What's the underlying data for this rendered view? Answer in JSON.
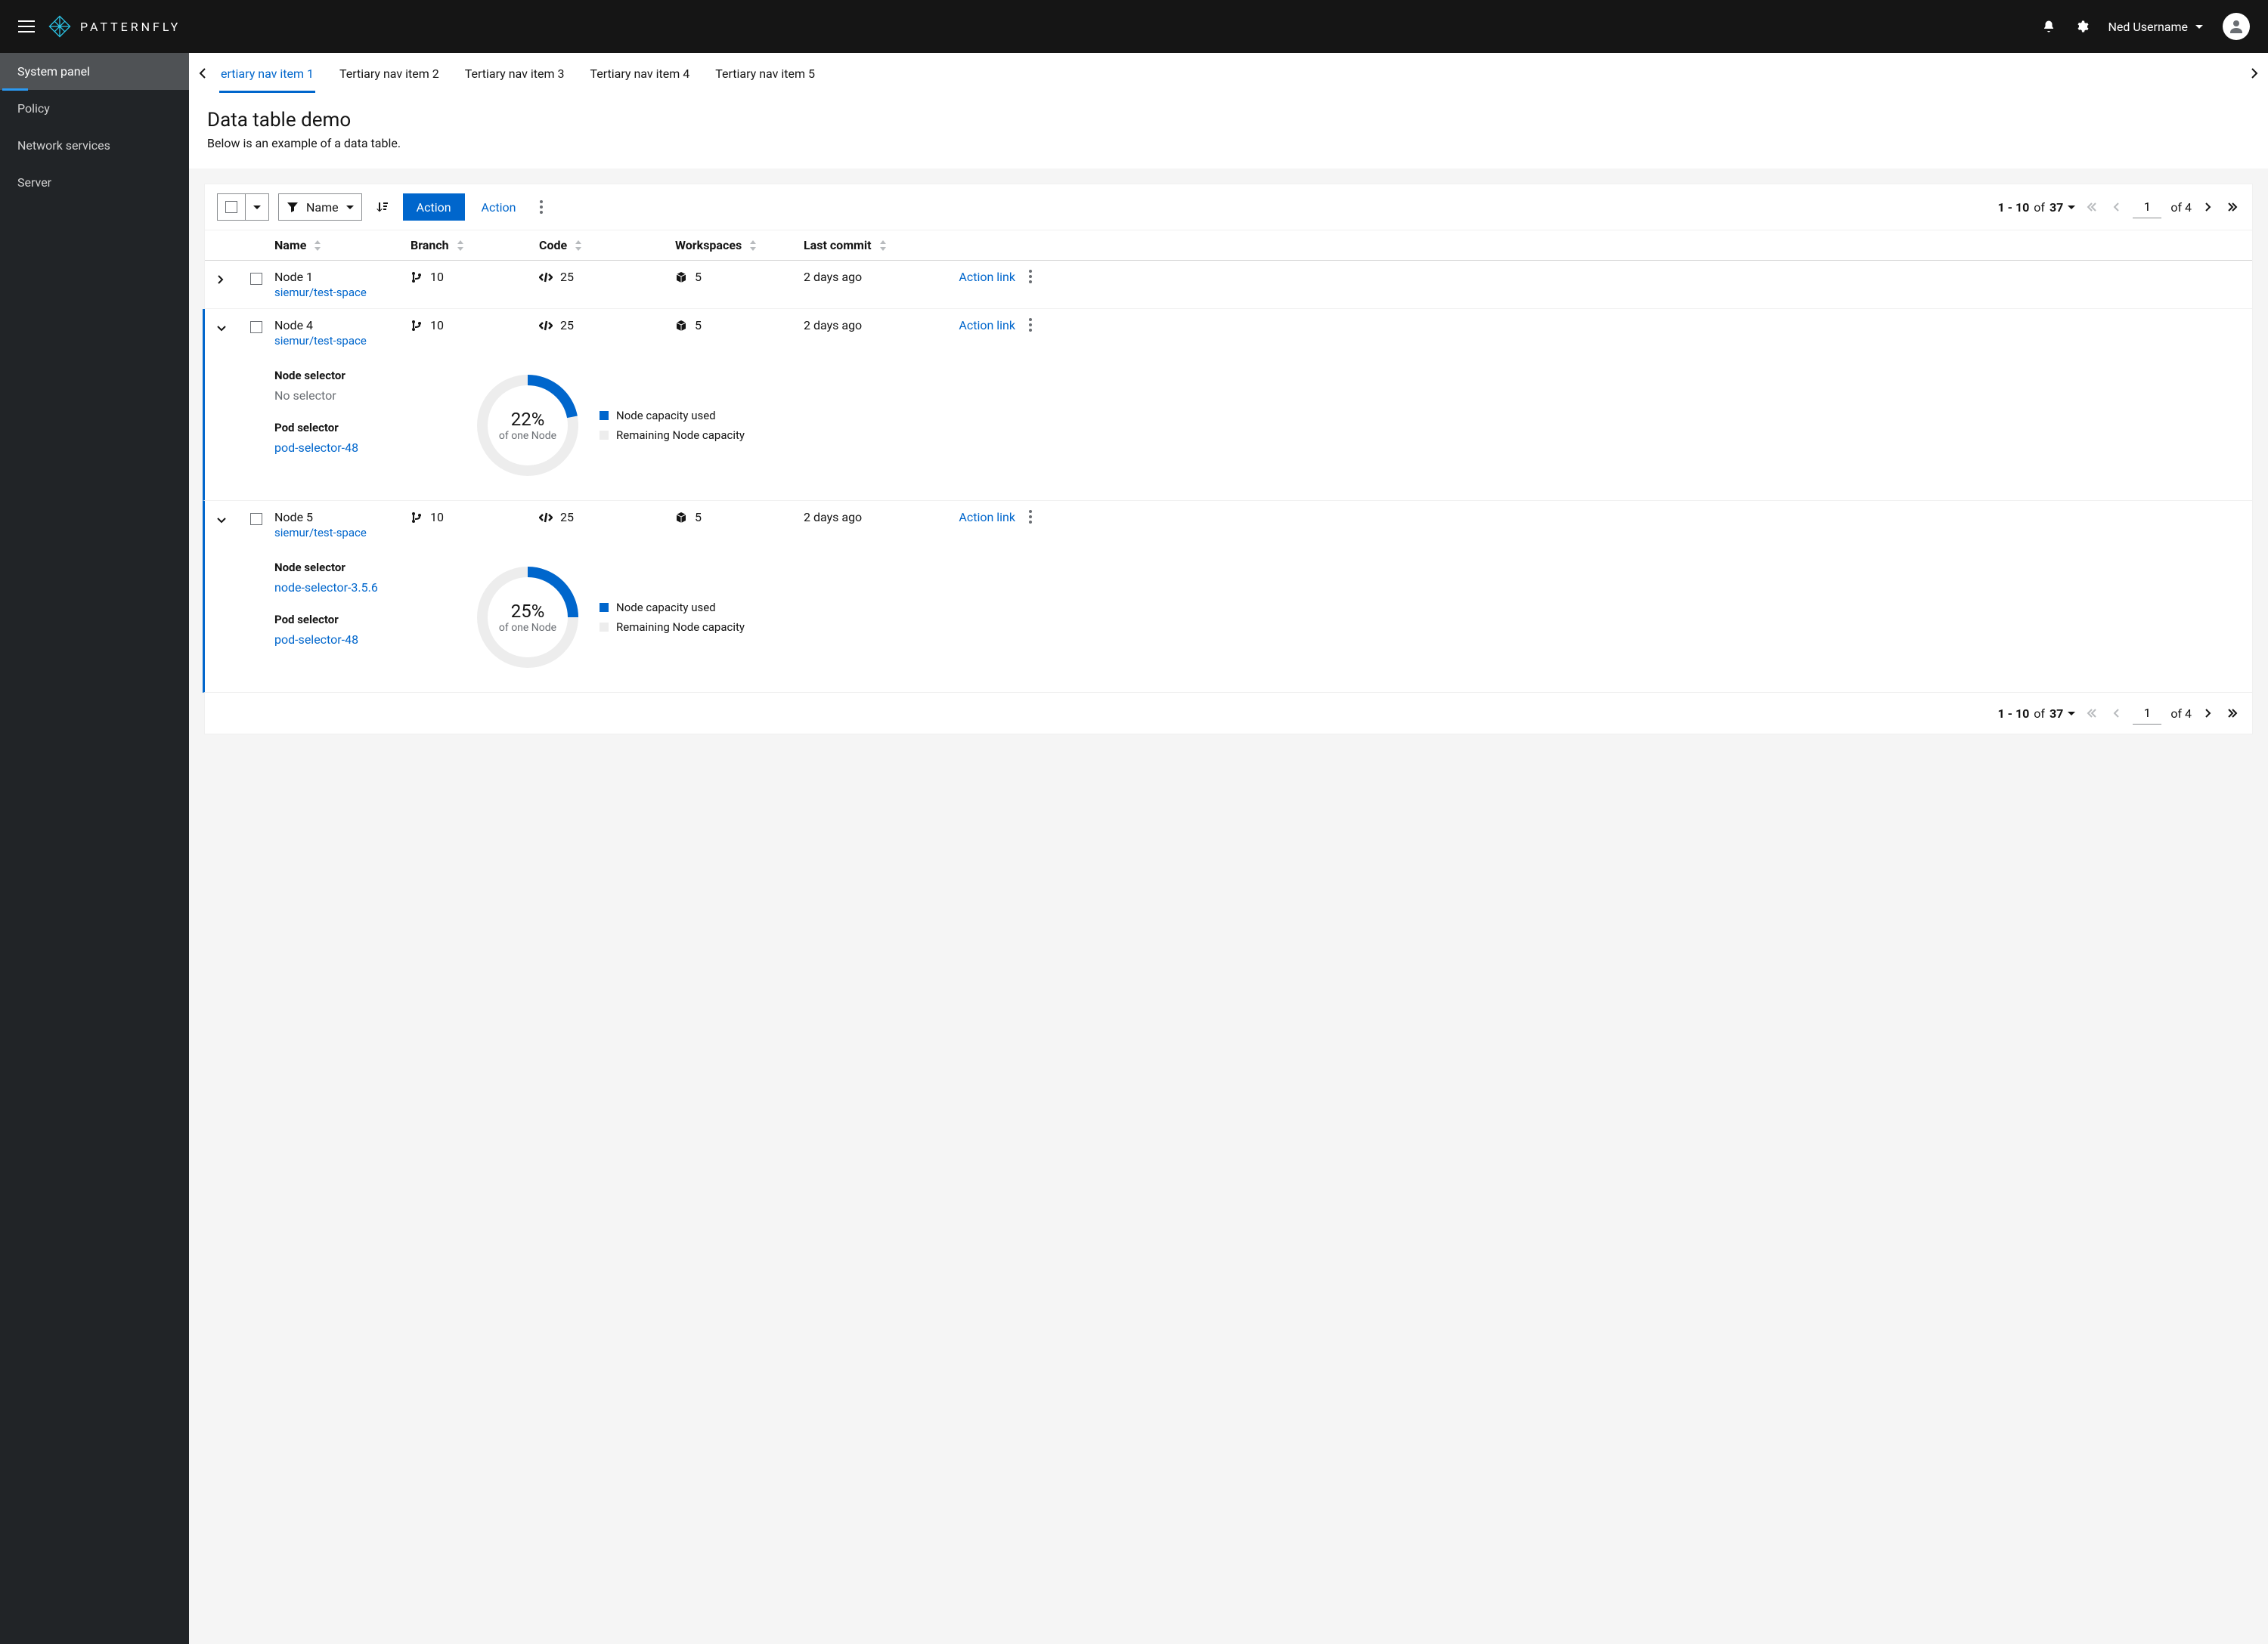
{
  "brand": {
    "text": "PATTERNFLY"
  },
  "masthead": {
    "username": "Ned Username"
  },
  "sidebar": {
    "items": [
      {
        "label": "System panel",
        "active": true
      },
      {
        "label": "Policy",
        "active": false
      },
      {
        "label": "Network services",
        "active": false
      },
      {
        "label": "Server",
        "active": false
      }
    ]
  },
  "tertiary": {
    "items": [
      {
        "label": "ertiary nav item 1",
        "active": true
      },
      {
        "label": "Tertiary nav item 2",
        "active": false
      },
      {
        "label": "Tertiary nav item 3",
        "active": false
      },
      {
        "label": "Tertiary nav item 4",
        "active": false
      },
      {
        "label": "Tertiary nav item 5",
        "active": false
      }
    ]
  },
  "page": {
    "title": "Data table demo",
    "subtitle": "Below is an example of a data table."
  },
  "toolbar": {
    "filter_label": "Name",
    "action_primary": "Action",
    "action_link": "Action"
  },
  "pagination": {
    "range_text": "1 - 10",
    "of_text": "of",
    "total": "37",
    "page_input": "1",
    "page_total": "4"
  },
  "columns": {
    "name": "Name",
    "branch": "Branch",
    "code": "Code",
    "workspaces": "Workspaces",
    "last_commit": "Last commit"
  },
  "labels": {
    "node_selector": "Node selector",
    "pod_selector": "Pod selector",
    "no_selector": "No selector",
    "legend_used": "Node capacity used",
    "legend_remaining": "Remaining Node capacity",
    "donut_sub": "of one Node",
    "action_link": "Action link"
  },
  "rows": [
    {
      "name": "Node 1",
      "subspace": "siemur/test-space",
      "branch": "10",
      "code": "25",
      "workspaces": "5",
      "last_commit": "2 days ago",
      "expanded": false
    },
    {
      "name": "Node 4",
      "subspace": "siemur/test-space",
      "branch": "10",
      "code": "25",
      "workspaces": "5",
      "last_commit": "2 days ago",
      "expanded": true,
      "detail": {
        "node_selector": null,
        "pod_selector": "pod-selector-48",
        "pct": 22
      }
    },
    {
      "name": "Node 5",
      "subspace": "siemur/test-space",
      "branch": "10",
      "code": "25",
      "workspaces": "5",
      "last_commit": "2 days ago",
      "expanded": true,
      "detail": {
        "node_selector": "node-selector-3.5.6",
        "pod_selector": "pod-selector-48",
        "pct": 25
      }
    }
  ],
  "colors": {
    "blue": "#0066cc",
    "gray_swatch": "#d2d2d2"
  },
  "chart_data": [
    {
      "type": "pie",
      "title": "Node 4 capacity",
      "series": [
        {
          "name": "Node capacity used",
          "value": 22
        },
        {
          "name": "Remaining Node capacity",
          "value": 78
        }
      ],
      "center_label": "22%",
      "center_sublabel": "of one Node"
    },
    {
      "type": "pie",
      "title": "Node 5 capacity",
      "series": [
        {
          "name": "Node capacity used",
          "value": 25
        },
        {
          "name": "Remaining Node capacity",
          "value": 75
        }
      ],
      "center_label": "25%",
      "center_sublabel": "of one Node"
    }
  ]
}
